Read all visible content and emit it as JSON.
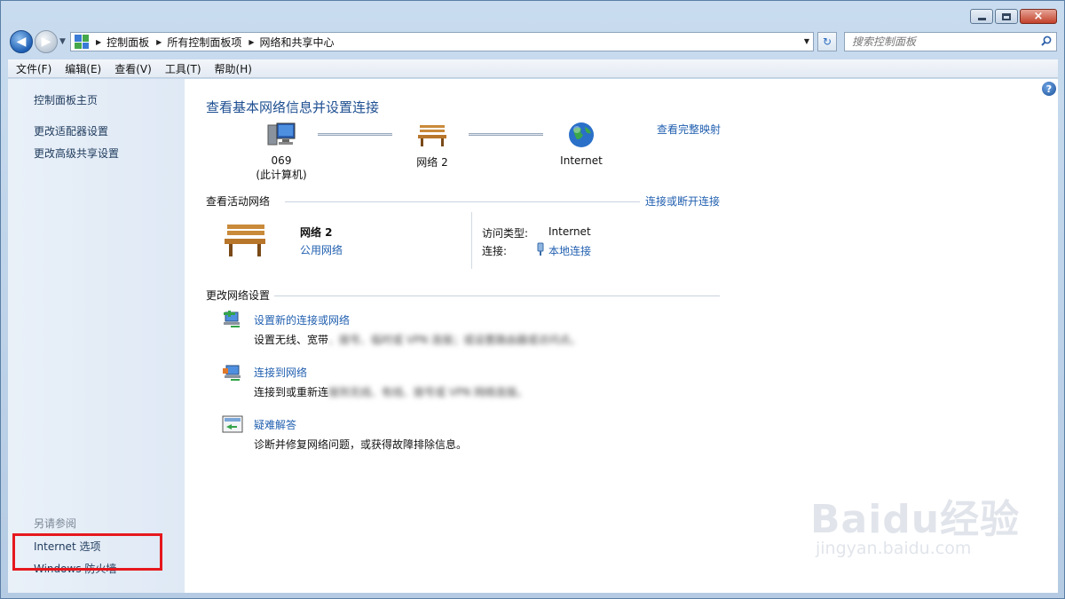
{
  "window": {
    "controls": {
      "close": "×"
    }
  },
  "nav": {
    "breadcrumbs": [
      "控制面板",
      "所有控制面板项",
      "网络和共享中心"
    ],
    "search_placeholder": "搜索控制面板"
  },
  "menu": [
    "文件(F)",
    "编辑(E)",
    "查看(V)",
    "工具(T)",
    "帮助(H)"
  ],
  "sidebar": {
    "links": [
      "控制面板主页",
      "更改适配器设置",
      "更改高级共享设置"
    ],
    "see_also_title": "另请参阅",
    "see_also_links": [
      "Internet 选项",
      "Windows 防火墙"
    ]
  },
  "main": {
    "title": "查看基本网络信息并设置连接",
    "full_map_link": "查看完整映射",
    "map": {
      "computer_line1": "069",
      "computer_line2": "(此计算机)",
      "network": "网络  2",
      "internet": "Internet"
    },
    "active": {
      "heading": "查看活动网络",
      "connect_link": "连接或断开连接",
      "network_name": "网络  2",
      "network_type": "公用网络",
      "access_type_label": "访问类型:",
      "access_type_value": "Internet",
      "connection_label": "连接:",
      "connection_value": "本地连接"
    },
    "settings": {
      "heading": "更改网络设置",
      "tasks": [
        {
          "title": "设置新的连接或网络",
          "desc": "设置无线、宽带",
          "desc_blurred": "、拨号、临时或 VPN 连接；或设置路由器或访问点。"
        },
        {
          "title": "连接到网络",
          "desc": "连接到或重新连",
          "desc_blurred": "接到无线、有线、拨号或 VPN 网络连接。"
        },
        {
          "title": "疑难解答",
          "desc": "诊断并修复网络问题，或获得故障排除信息。",
          "desc_blurred": ""
        }
      ]
    }
  },
  "watermark": {
    "brand": "Baidu经验",
    "url": "jingyan.baidu.com"
  },
  "colors": {
    "link": "#2260b0",
    "title": "#1e4f91",
    "highlight_box": "#e6181e"
  }
}
